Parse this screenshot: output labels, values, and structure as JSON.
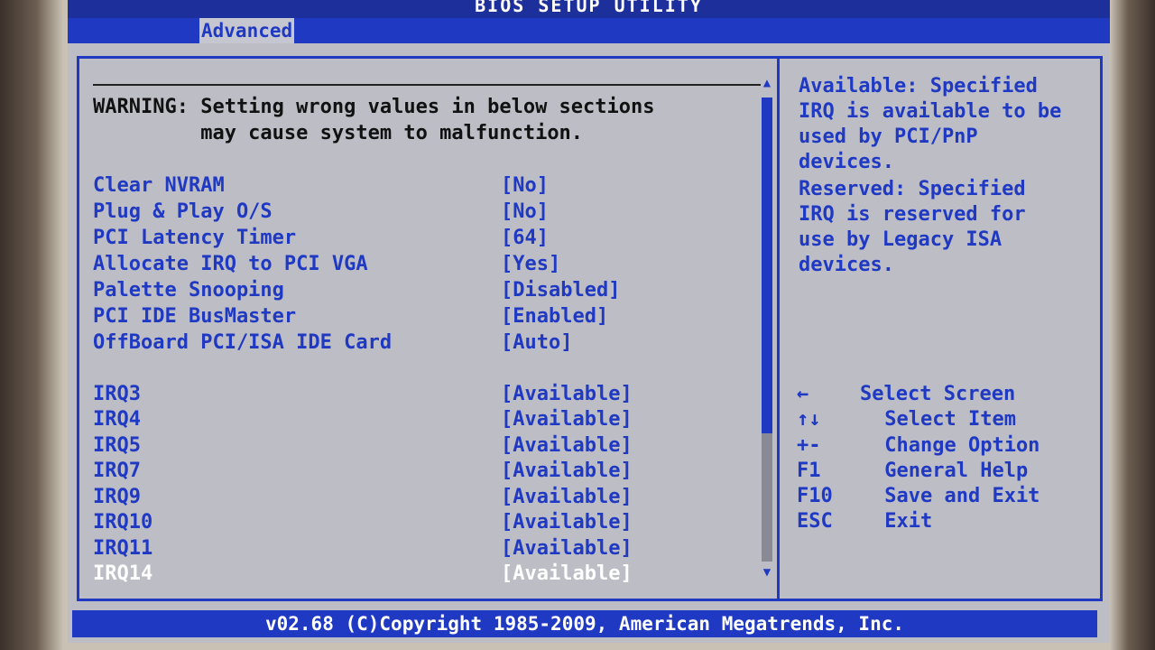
{
  "title": "BIOS SETUP UTILITY",
  "tab": "Advanced",
  "warning": {
    "line1": "WARNING: Setting wrong values in below sections",
    "line2": "         may cause system to malfunction."
  },
  "settings": [
    {
      "label": "Clear NVRAM",
      "value": "[No]"
    },
    {
      "label": "Plug & Play O/S",
      "value": "[No]"
    },
    {
      "label": "PCI Latency Timer",
      "value": "[64]"
    },
    {
      "label": "Allocate IRQ to PCI VGA",
      "value": "[Yes]"
    },
    {
      "label": "Palette Snooping",
      "value": "[Disabled]"
    },
    {
      "label": "PCI IDE BusMaster",
      "value": "[Enabled]"
    },
    {
      "label": "OffBoard PCI/ISA IDE Card",
      "value": "[Auto]"
    }
  ],
  "irqs": [
    {
      "label": "IRQ3",
      "value": "[Available]"
    },
    {
      "label": "IRQ4",
      "value": "[Available]"
    },
    {
      "label": "IRQ5",
      "value": "[Available]"
    },
    {
      "label": "IRQ7",
      "value": "[Available]"
    },
    {
      "label": "IRQ9",
      "value": "[Available]"
    },
    {
      "label": "IRQ10",
      "value": "[Available]"
    },
    {
      "label": "IRQ11",
      "value": "[Available]"
    },
    {
      "label": "IRQ14",
      "value": "[Available]"
    }
  ],
  "help": [
    "Available: Specified",
    "IRQ is available to be",
    "used by PCI/PnP",
    "devices.",
    "Reserved: Specified",
    "IRQ is reserved for",
    "use by Legacy ISA",
    "devices."
  ],
  "keys": [
    {
      "key": "←",
      "action": "Select Screen"
    },
    {
      "key": "↑↓",
      "action": " Select Item"
    },
    {
      "key": "+-",
      "action": " Change Option"
    },
    {
      "key": "F1",
      "action": " General Help"
    },
    {
      "key": "F10",
      "action": " Save and Exit"
    },
    {
      "key": "ESC",
      "action": " Exit"
    }
  ],
  "copyright": "v02.68 (C)Copyright 1985-2009, American Megatrends, Inc.",
  "colors": {
    "accent": "#1f39c2",
    "background": "#bdbdc6",
    "highlight": "#ffffff"
  }
}
